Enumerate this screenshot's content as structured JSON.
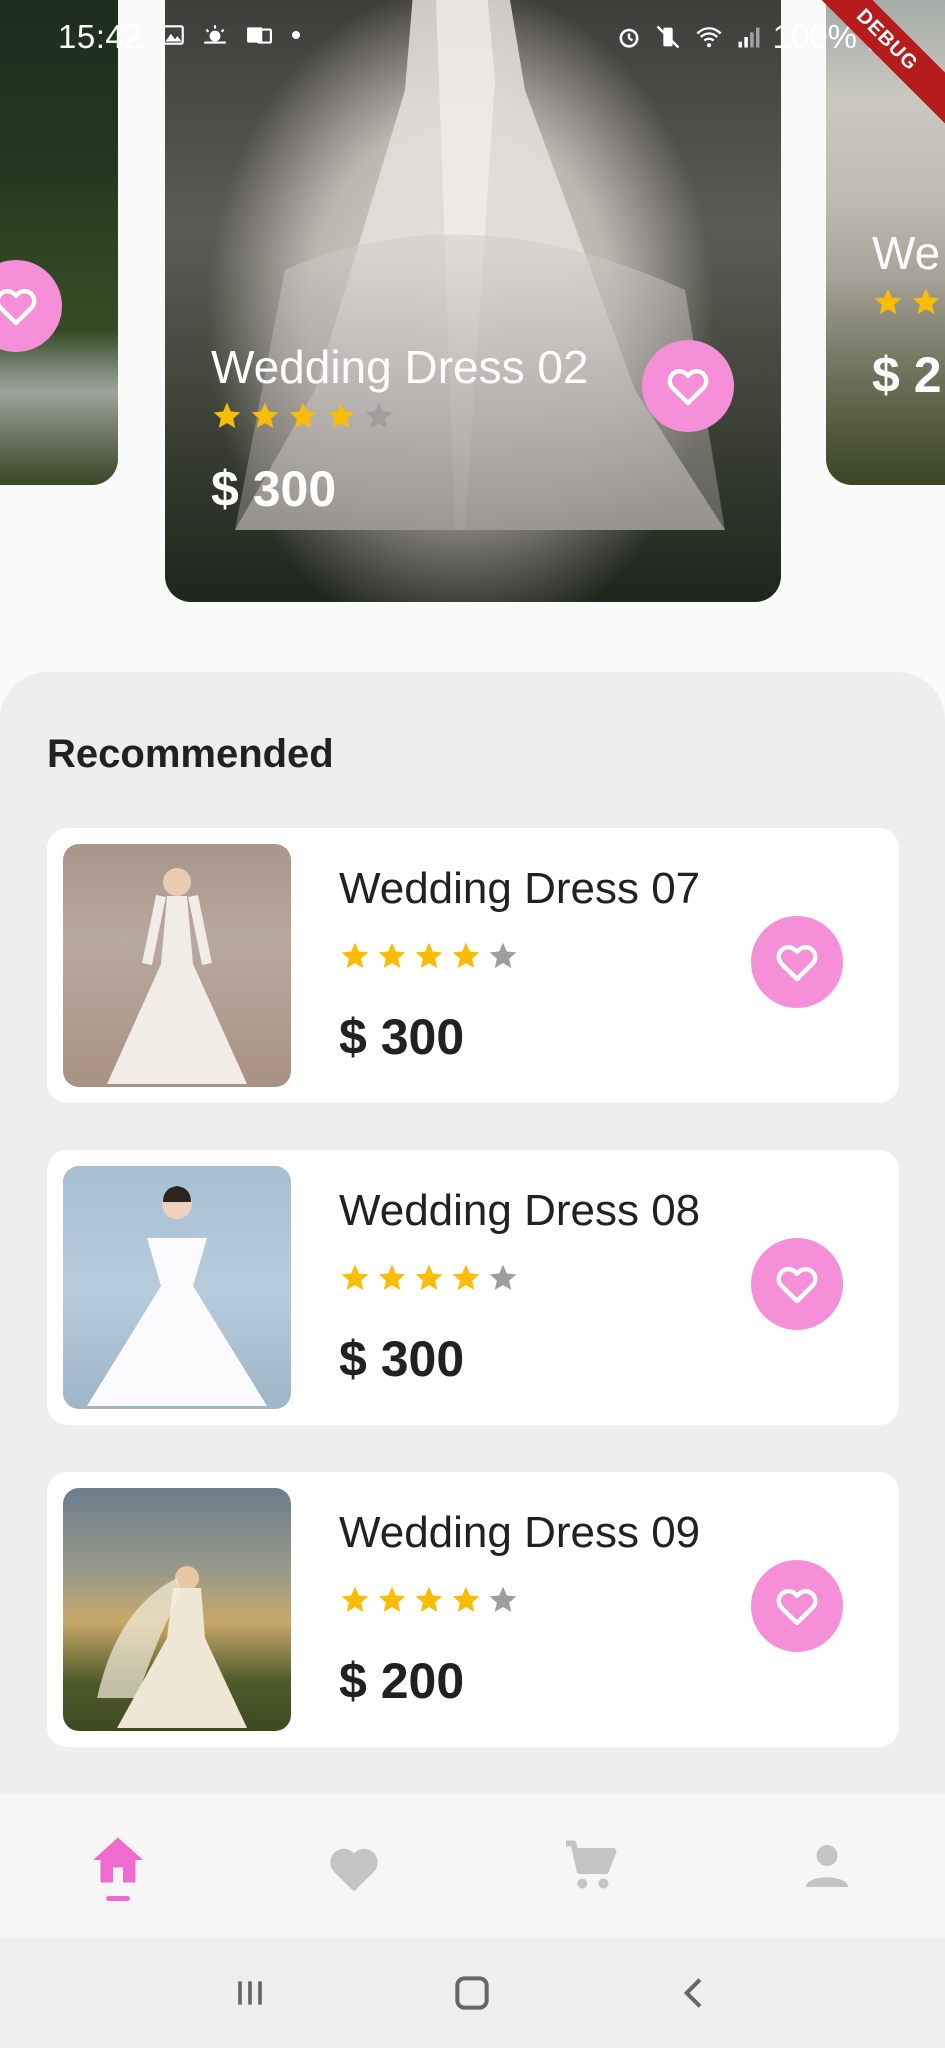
{
  "status_bar": {
    "time": "15:42",
    "battery": "100%",
    "debug_banner": "DEBUG"
  },
  "carousel": {
    "center": {
      "title": "Wedding Dress 02",
      "rating": 4,
      "max_rating": 5,
      "price": "$ 300"
    },
    "right": {
      "title": "We",
      "price": "$ 2"
    }
  },
  "recommended": {
    "heading": "Recommended",
    "items": [
      {
        "title": "Wedding Dress 07",
        "rating": 4,
        "max_rating": 5,
        "price": "$ 300"
      },
      {
        "title": "Wedding Dress 08",
        "rating": 4,
        "max_rating": 5,
        "price": "$ 300"
      },
      {
        "title": "Wedding Dress 09",
        "rating": 4,
        "max_rating": 5,
        "price": "$ 200"
      }
    ]
  },
  "bottom_nav": {
    "items": [
      {
        "icon": "home-icon",
        "active": true
      },
      {
        "icon": "heart-icon",
        "active": false
      },
      {
        "icon": "cart-icon",
        "active": false
      },
      {
        "icon": "person-icon",
        "active": false
      }
    ]
  },
  "colors": {
    "accent": "#f48fd8",
    "star_filled": "#fbbc05",
    "star_empty": "#9e9e9e",
    "nav_active": "#f06bd0",
    "nav_inactive": "#c4c4c4"
  }
}
